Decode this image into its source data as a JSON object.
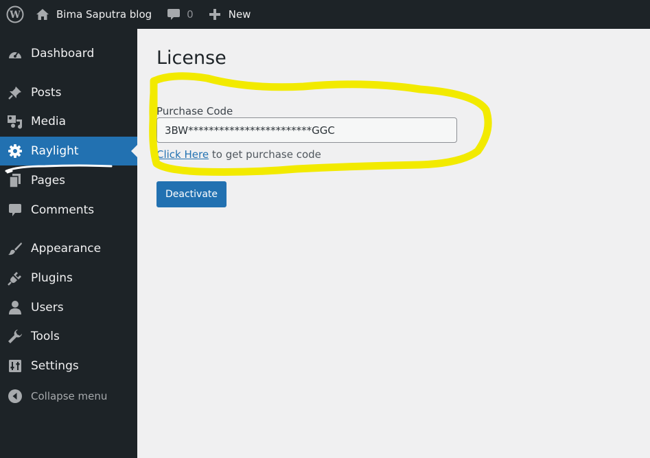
{
  "adminbar": {
    "site_name": "Bima Saputra blog",
    "comment_count": "0",
    "new_label": "New"
  },
  "sidebar": {
    "items": [
      {
        "label": "Dashboard",
        "icon": "dashboard-icon"
      },
      {
        "label": "Posts",
        "icon": "pin-icon"
      },
      {
        "label": "Media",
        "icon": "media-icon"
      },
      {
        "label": "Raylight",
        "icon": "gear-icon"
      },
      {
        "label": "Pages",
        "icon": "pages-icon"
      },
      {
        "label": "Comments",
        "icon": "comment-icon"
      },
      {
        "label": "Appearance",
        "icon": "brush-icon"
      },
      {
        "label": "Plugins",
        "icon": "plug-icon"
      },
      {
        "label": "Users",
        "icon": "user-icon"
      },
      {
        "label": "Tools",
        "icon": "wrench-icon"
      },
      {
        "label": "Settings",
        "icon": "settings-icon"
      }
    ],
    "collapse_label": "Collapse menu",
    "current": "Raylight"
  },
  "main": {
    "title": "License",
    "purchase_code_label": "Purchase Code",
    "purchase_code_value": "3BW************************GGC",
    "help_link_text": "Click Here",
    "help_suffix": " to get purchase code",
    "deactivate_label": "Deactivate"
  },
  "colors": {
    "admin_dark": "#1d2327",
    "accent": "#2271b1",
    "highlight_marker": "#f2ea00",
    "content_bg": "#f0f0f1"
  }
}
